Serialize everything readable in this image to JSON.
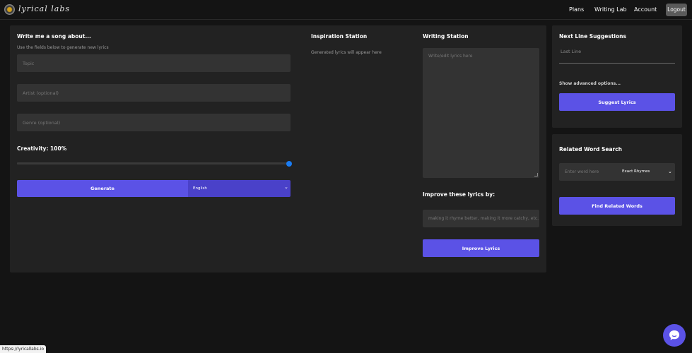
{
  "header": {
    "logo_text": "lyrical labs",
    "nav": {
      "plans": "Plans",
      "writing_lab": "Writing Lab",
      "account": "Account",
      "logout": "Logout"
    }
  },
  "song_form": {
    "title": "Write me a song about...",
    "subtitle": "Use the fields below to generate new lyrics",
    "topic_placeholder": "Topic",
    "artist_placeholder": "Artist (optional)",
    "genre_placeholder": "Genre (optional)",
    "creativity_label": "Creativity: 100%",
    "creativity_value": 1.0,
    "generate_label": "Generate",
    "language_selected": "English"
  },
  "inspiration": {
    "title": "Inspiration Station",
    "placeholder": "Generated lyrics will appear here"
  },
  "writing": {
    "title": "Writing Station",
    "placeholder": "Write/edit lyrics here",
    "improve_label": "Improve these lyrics by:",
    "improve_placeholder": "making it rhyme better, making it more catchy, etc.",
    "improve_button": "Improve Lyrics"
  },
  "next_line": {
    "title": "Next Line Suggestions",
    "last_line_placeholder": "Last Line",
    "advanced_link": "Show advanced options...",
    "suggest_button": "Suggest Lyrics"
  },
  "related": {
    "title": "Related Word Search",
    "word_placeholder": "Enter word here",
    "mode_selected": "Exact Rhymes",
    "find_button": "Find Related Words"
  },
  "status_bar": {
    "url": "https://lyricallabs.io"
  },
  "colors": {
    "accent": "#5b52e6",
    "panel": "#222222",
    "background": "#141414",
    "slider_thumb": "#1a7cf2"
  },
  "icons": {
    "logo": "vinyl-record-icon",
    "chat": "chat-bubble-icon",
    "chevron": "chevron-down-icon"
  }
}
